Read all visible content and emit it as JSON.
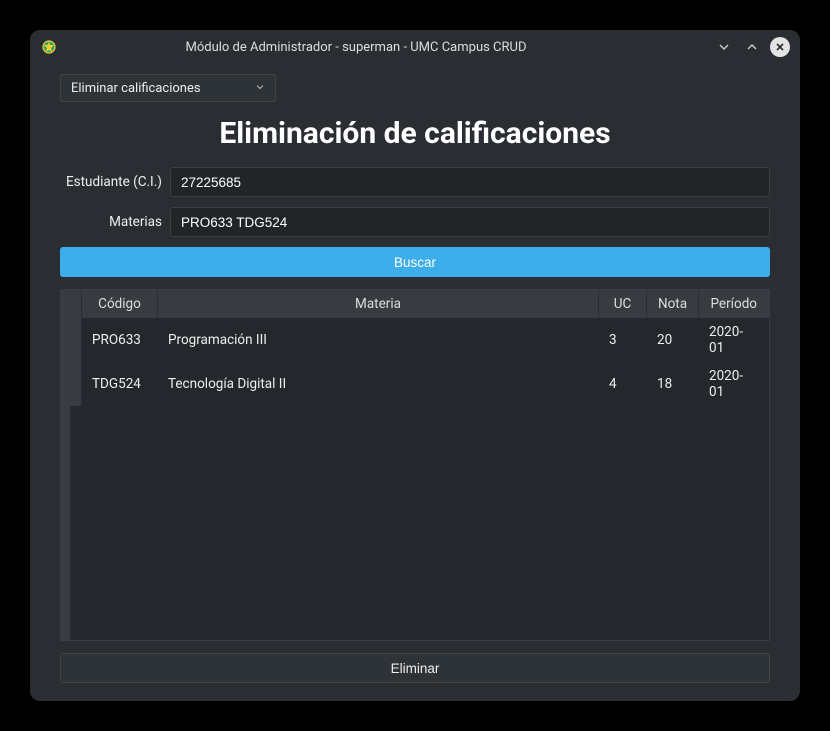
{
  "window": {
    "title": "Módulo de Administrador - superman - UMC Campus CRUD"
  },
  "combo": {
    "selected": "Eliminar calificaciones"
  },
  "page": {
    "title": "Eliminación de calificaciones"
  },
  "form": {
    "student_label": "Estudiante (C.I.)",
    "student_value": "27225685",
    "subjects_label": "Materias",
    "subjects_value": "PRO633 TDG524",
    "search_label": "Buscar",
    "delete_label": "Eliminar"
  },
  "table": {
    "headers": {
      "codigo": "Código",
      "materia": "Materia",
      "uc": "UC",
      "nota": "Nota",
      "periodo": "Período"
    },
    "rows": [
      {
        "codigo": "PRO633",
        "materia": "Programación III",
        "uc": "3",
        "nota": "20",
        "periodo": "2020-01"
      },
      {
        "codigo": "TDG524",
        "materia": "Tecnología Digital II",
        "uc": "4",
        "nota": "18",
        "periodo": "2020-01"
      }
    ]
  }
}
